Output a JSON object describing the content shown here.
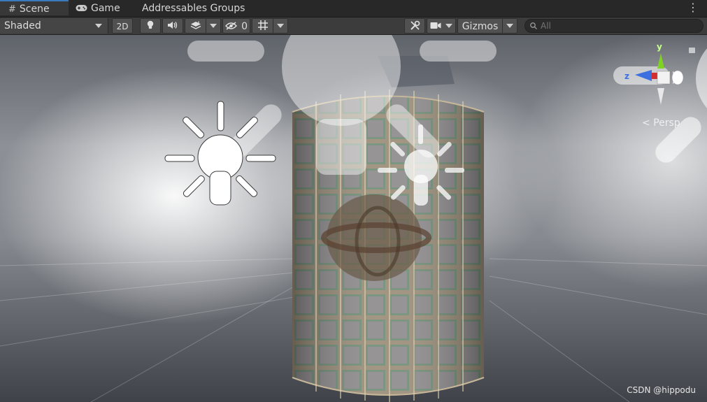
{
  "tabs": [
    {
      "label": "Scene",
      "icon": "grid-hash-icon",
      "active": true
    },
    {
      "label": "Game",
      "icon": "gamepad-icon",
      "active": false
    },
    {
      "label": "Addressables Groups",
      "active": false
    }
  ],
  "toolbar": {
    "draw_mode": "Shaded",
    "two_d_label": "2D",
    "hidden_count": "0",
    "gizmos_label": "Gizmos",
    "search_placeholder": "All"
  },
  "gizmo": {
    "y_label": "y",
    "z_label": "z",
    "projection_label": "Persp"
  },
  "watermark": "CSDN @hippodu",
  "colors": {
    "tab_accent": "#3a79bb",
    "axis_y": "#7fd321",
    "axis_z": "#3c6fe0",
    "axis_x": "#d23030"
  }
}
